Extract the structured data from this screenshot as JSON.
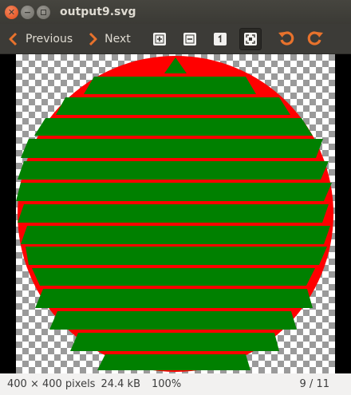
{
  "window": {
    "title": "output9.svg"
  },
  "toolbar": {
    "previous_label": "Previous",
    "next_label": "Next"
  },
  "image": {
    "circle_color": "#ff0000",
    "stripe_color": "#008000",
    "checker_light": "#ffffff",
    "checker_dark": "#9a9a9a"
  },
  "status": {
    "dimensions": "400 × 400 pixels",
    "file_size": "24.4 kB",
    "zoom": "100%",
    "position": "9 / 11"
  },
  "icons": {
    "close": "close-icon",
    "minimize": "minimize-icon",
    "maximize": "maximize-icon",
    "previous": "chevron-left-icon",
    "next": "chevron-right-icon",
    "zoom_in": "zoom-in-icon",
    "zoom_out": "zoom-out-icon",
    "zoom_normal": "zoom-normal-icon",
    "best_fit": "best-fit-icon",
    "rotate_left": "rotate-left-icon",
    "rotate_right": "rotate-right-icon"
  }
}
